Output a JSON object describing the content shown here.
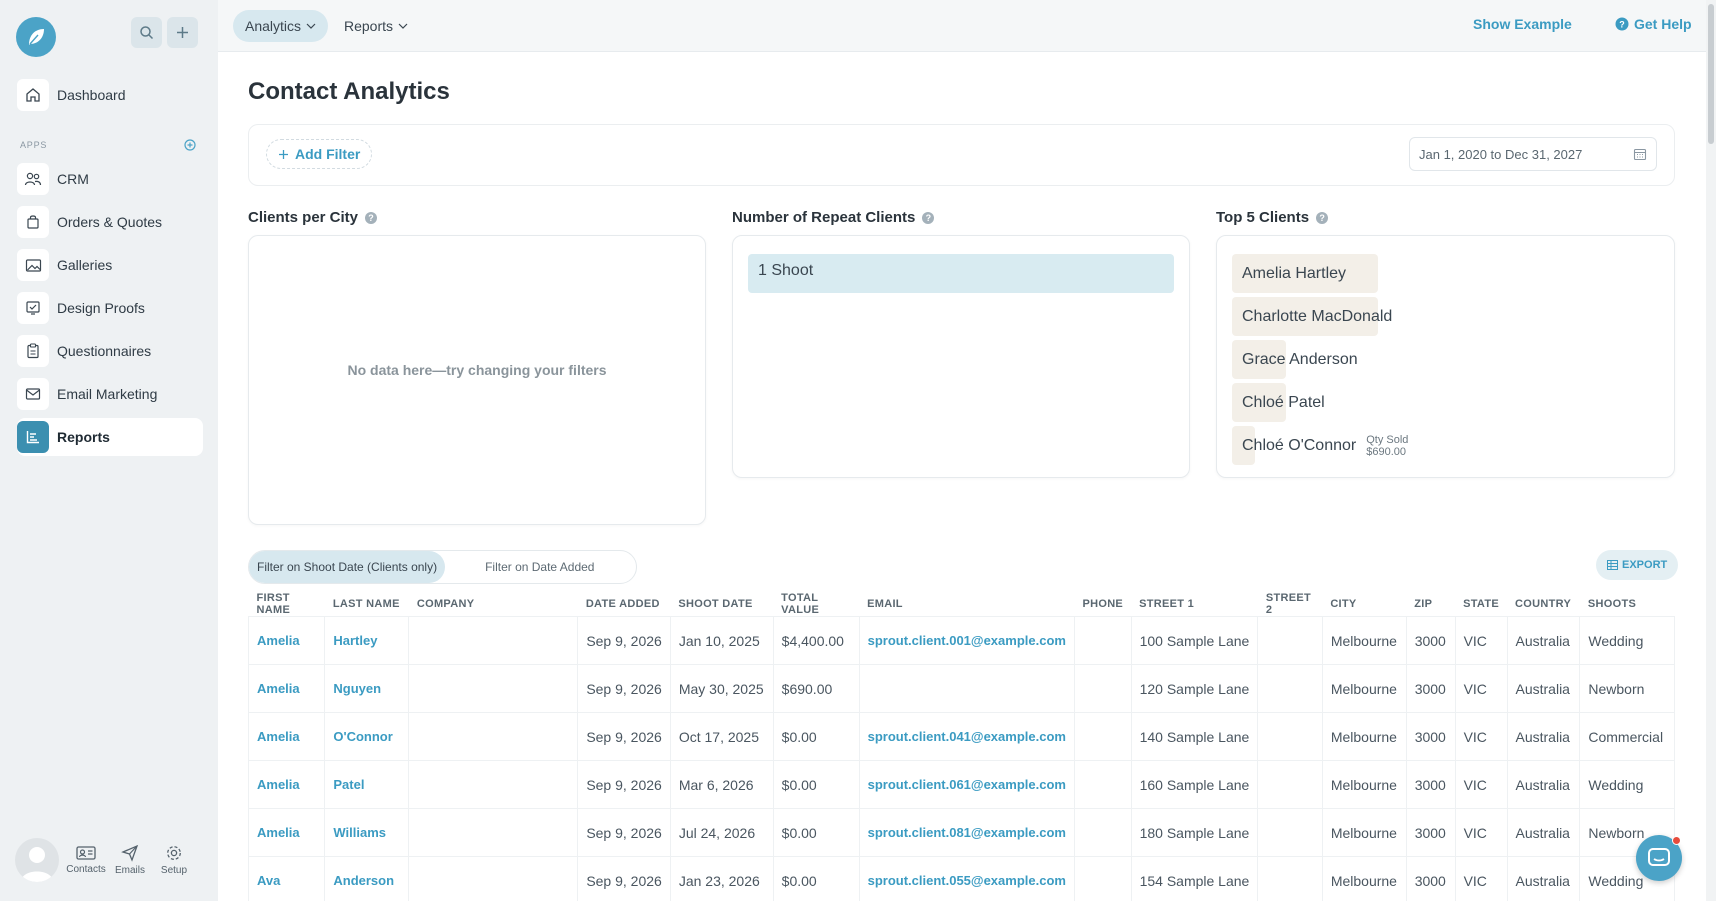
{
  "topbar": {
    "tabs": [
      {
        "label": "Analytics"
      },
      {
        "label": "Reports"
      }
    ],
    "show_example": "Show Example",
    "get_help": "Get Help"
  },
  "sidebar": {
    "dashboard": "Dashboard",
    "apps_heading": "APPS",
    "items": [
      {
        "label": "CRM",
        "icon": "users-icon"
      },
      {
        "label": "Orders & Quotes",
        "icon": "shopping-bag-icon"
      },
      {
        "label": "Galleries",
        "icon": "image-icon"
      },
      {
        "label": "Design Proofs",
        "icon": "proof-check-icon"
      },
      {
        "label": "Questionnaires",
        "icon": "clipboard-icon"
      },
      {
        "label": "Email Marketing",
        "icon": "mail-icon"
      },
      {
        "label": "Reports",
        "icon": "chart-icon"
      }
    ],
    "bottom": {
      "contacts": "Contacts",
      "emails": "Emails",
      "setup": "Setup"
    }
  },
  "page": {
    "title": "Contact Analytics",
    "add_filter": "Add Filter",
    "date_range": "Jan 1, 2020 to Dec 31, 2027"
  },
  "cards": {
    "clients_per_city": {
      "title": "Clients per City",
      "empty": "No data here—try changing your filters"
    },
    "repeat_clients": {
      "title": "Number of Repeat Clients",
      "bar_label": "1 Shoot"
    },
    "top_clients": {
      "title": "Top 5 Clients",
      "clients": [
        {
          "name": "Amelia Hartley",
          "relative_value": 1.0
        },
        {
          "name": "Charlotte MacDonald",
          "relative_value": 1.0
        },
        {
          "name": "Grace Anderson",
          "relative_value": 0.36
        },
        {
          "name": "Chloé Patel",
          "relative_value": 0.36
        },
        {
          "name": "Chloé O'Connor",
          "relative_value": 0.16
        }
      ],
      "tooltip_label": "Qty Sold",
      "tooltip_value": "$690.00"
    }
  },
  "table_controls": {
    "filter_shoot": "Filter on Shoot Date (Clients only)",
    "filter_added": "Filter on Date Added",
    "export": "EXPORT"
  },
  "table": {
    "headers": [
      "FIRST NAME",
      "LAST NAME",
      "COMPANY",
      "DATE ADDED",
      "SHOOT DATE",
      "TOTAL VALUE",
      "EMAIL",
      "PHONE",
      "STREET 1",
      "STREET 2",
      "CITY",
      "ZIP",
      "STATE",
      "COUNTRY",
      "SHOOTS"
    ],
    "rows": [
      [
        "Amelia",
        "Hartley",
        "",
        "Sep 9, 2026",
        "Jan 10, 2025",
        "$4,400.00",
        "sprout.client.001@example.com",
        "",
        "100 Sample Lane",
        "",
        "Melbourne",
        "3000",
        "VIC",
        "Australia",
        "Wedding"
      ],
      [
        "Amelia",
        "Nguyen",
        "",
        "Sep 9, 2026",
        "May 30, 2025",
        "$690.00",
        "",
        "",
        "120 Sample Lane",
        "",
        "Melbourne",
        "3000",
        "VIC",
        "Australia",
        "Newborn"
      ],
      [
        "Amelia",
        "O'Connor",
        "",
        "Sep 9, 2026",
        "Oct 17, 2025",
        "$0.00",
        "sprout.client.041@example.com",
        "",
        "140 Sample Lane",
        "",
        "Melbourne",
        "3000",
        "VIC",
        "Australia",
        "Commercial"
      ],
      [
        "Amelia",
        "Patel",
        "",
        "Sep 9, 2026",
        "Mar 6, 2026",
        "$0.00",
        "sprout.client.061@example.com",
        "",
        "160 Sample Lane",
        "",
        "Melbourne",
        "3000",
        "VIC",
        "Australia",
        "Wedding"
      ],
      [
        "Amelia",
        "Williams",
        "",
        "Sep 9, 2026",
        "Jul 24, 2026",
        "$0.00",
        "sprout.client.081@example.com",
        "",
        "180 Sample Lane",
        "",
        "Melbourne",
        "3000",
        "VIC",
        "Australia",
        "Newborn"
      ],
      [
        "Ava",
        "Anderson",
        "",
        "Sep 9, 2026",
        "Jan 23, 2026",
        "$0.00",
        "sprout.client.055@example.com",
        "",
        "154 Sample Lane",
        "",
        "Melbourne",
        "3000",
        "VIC",
        "Australia",
        "Wedding"
      ]
    ]
  },
  "colors": {
    "accent": "#3b9bc2",
    "brand": "#4ba3c7",
    "highlight": "#d7e8ef",
    "top_bar_fill": "#f3efe8"
  }
}
